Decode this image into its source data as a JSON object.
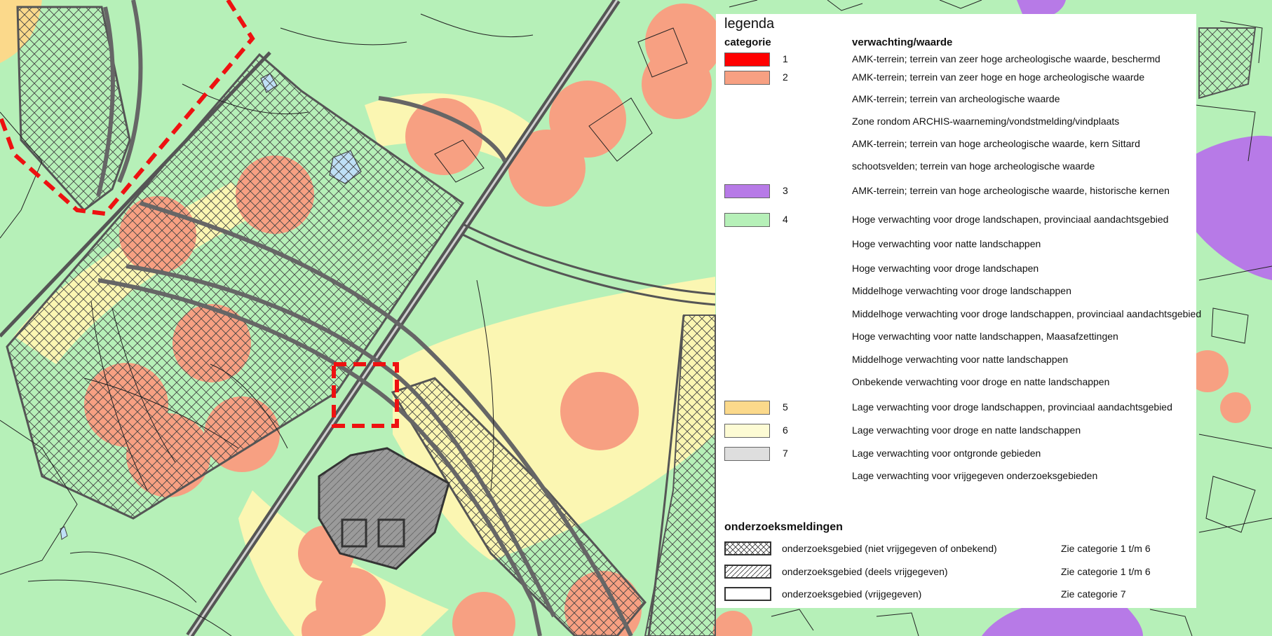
{
  "colors": {
    "green": "#b6f0b8",
    "yellow": "#fbf6b2",
    "orange": "#f7a082",
    "purple": "#b77ae7",
    "red": "#ee1111",
    "road": "#555555",
    "grey": "#9a9a9a",
    "light_blue": "#bfe0f6",
    "light_orange": "#fbd98b"
  },
  "legend": {
    "title": "legenda",
    "col_categorie": "categorie",
    "col_verwachting": "verwachting/waarde",
    "rows": [
      {
        "num": "1",
        "swatch": "#ff0000",
        "text": "AMK-terrein; terrein van zeer hoge archeologische waarde, beschermd"
      },
      {
        "num": "2",
        "swatch": "#f7a082",
        "text": "AMK-terrein; terrein van zeer hoge en hoge archeologische waarde"
      },
      {
        "num": "",
        "swatch": null,
        "text": "AMK-terrein; terrein van archeologische waarde"
      },
      {
        "num": "",
        "swatch": null,
        "text": "Zone rondom ARCHIS-waarneming/vondstmelding/vindplaats"
      },
      {
        "num": "",
        "swatch": null,
        "text": "AMK-terrein; terrein van hoge archeologische waarde, kern Sittard"
      },
      {
        "num": "",
        "swatch": null,
        "text": "schootsvelden; terrein van hoge archeologische waarde"
      },
      {
        "num": "3",
        "swatch": "#b77ae7",
        "text": "AMK-terrein; terrein van hoge archeologische waarde, historische kernen"
      },
      {
        "num": "4",
        "swatch": "#b6f0b8",
        "text": "Hoge verwachting voor droge landschapen, provinciaal aandachtsgebied"
      },
      {
        "num": "",
        "swatch": null,
        "text": "Hoge verwachting voor natte landschappen"
      },
      {
        "num": "",
        "swatch": null,
        "text": "Hoge verwachting voor droge landschapen"
      },
      {
        "num": "",
        "swatch": null,
        "text": "Middelhoge verwachting voor droge landschappen"
      },
      {
        "num": "",
        "swatch": null,
        "text": "Middelhoge verwachting voor droge landschappen, provinciaal aandachtsgebied"
      },
      {
        "num": "",
        "swatch": null,
        "text": "Hoge verwachting voor natte landschappen, Maasafzettingen"
      },
      {
        "num": "",
        "swatch": null,
        "text": "Middelhoge verwachting voor natte landschappen"
      },
      {
        "num": "",
        "swatch": null,
        "text": "Onbekende verwachting voor droge en natte landschappen"
      },
      {
        "num": "5",
        "swatch": "#fbd98b",
        "text": "Lage verwachting voor droge landschappen, provinciaal aandachtsgebied"
      },
      {
        "num": "6",
        "swatch": "#fdfbd4",
        "text": "Lage verwachting voor droge en natte landschappen"
      },
      {
        "num": "7",
        "swatch": "#dedede",
        "text": "Lage verwachting voor ontgronde gebieden"
      },
      {
        "num": "",
        "swatch": null,
        "text": "Lage verwachting voor vrijgegeven onderzoeksgebieden"
      }
    ]
  },
  "onderzoeksmeldingen": {
    "title": "onderzoeksmeldingen",
    "items": [
      {
        "label": "onderzoeksgebied (niet vrijgegeven of onbekend)",
        "ref": "Zie categorie 1 t/m 6",
        "pattern": "cross"
      },
      {
        "label": "onderzoeksgebied (deels vrijgegeven)",
        "ref": "Zie categorie 1 t/m 6",
        "pattern": "diag"
      },
      {
        "label": "onderzoeksgebied (vrijgegeven)",
        "ref": "Zie categorie 7",
        "pattern": "none"
      }
    ]
  }
}
